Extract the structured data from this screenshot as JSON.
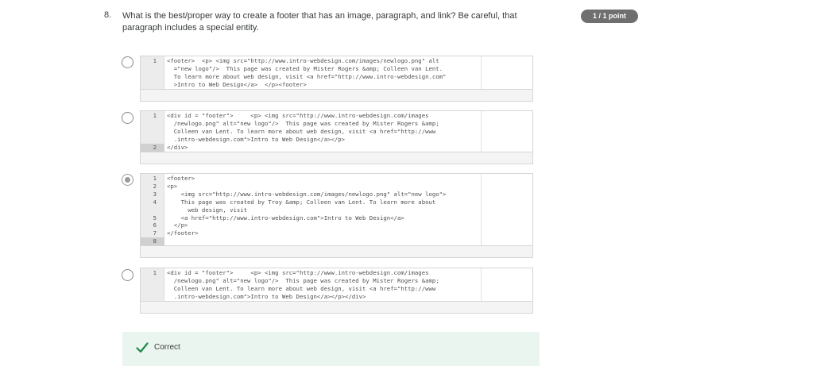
{
  "question": {
    "number": "8.",
    "text": "What is the best/proper way to create a footer that has an image, paragraph, and link? Be careful, that paragraph includes a special entity."
  },
  "score": {
    "label": "1 / 1 point"
  },
  "options": [
    {
      "selected": false,
      "lines": [
        {
          "num": "1",
          "text": "<footer>  <p> <img src=\"http://www.intro-webdesign.com/images/newlogo.png\" alt"
        },
        {
          "num": "",
          "text": "  =\"new logo\"/>  This page was created by Mister Rogers &amp; Colleen van Lent."
        },
        {
          "num": "",
          "text": "  To learn more about web design, visit <a href=\"http://www.intro-webdesign.com\""
        },
        {
          "num": "",
          "text": "  >Intro to Web Design</a>  </p><footer>"
        }
      ]
    },
    {
      "selected": false,
      "lines": [
        {
          "num": "1",
          "text": "<div id = \"footer\">     <p> <img src=\"http://www.intro-webdesign.com/images"
        },
        {
          "num": "",
          "text": "  /newlogo.png\" alt=\"new logo\"/>  This page was created by Mister Rogers &amp;"
        },
        {
          "num": "",
          "text": "  Colleen van Lent. To learn more about web design, visit <a href=\"http://www"
        },
        {
          "num": "",
          "text": "  .intro-webdesign.com\">Intro to Web Design</a></p>"
        },
        {
          "num": "2",
          "text": "</div>"
        }
      ]
    },
    {
      "selected": true,
      "lines": [
        {
          "num": "1",
          "text": "<footer>"
        },
        {
          "num": "2",
          "text": "<p>"
        },
        {
          "num": "3",
          "text": "    <img src=\"http://www.intro-webdesign.com/images/newlogo.png\" alt=\"new logo\">"
        },
        {
          "num": "4",
          "text": "    This page was created by Troy &amp; Colleen van Lent. To learn more about"
        },
        {
          "num": "",
          "text": "      web design, visit"
        },
        {
          "num": "5",
          "text": "    <a href=\"http://www.intro-webdesign.com\">Intro to Web Design</a>"
        },
        {
          "num": "6",
          "text": "  </p>"
        },
        {
          "num": "7",
          "text": "</footer>"
        },
        {
          "num": "8",
          "text": ""
        }
      ]
    },
    {
      "selected": false,
      "lines": [
        {
          "num": "1",
          "text": "<div id = \"footer\">     <p> <img src=\"http://www.intro-webdesign.com/images"
        },
        {
          "num": "",
          "text": "  /newlogo.png\" alt=\"new logo\"/>  This page was created by Mister Rogers &amp;"
        },
        {
          "num": "",
          "text": "  Colleen van Lent. To learn more about web design, visit <a href=\"http://www"
        },
        {
          "num": "",
          "text": "  .intro-webdesign.com\">Intro to Web Design</a></p></div>"
        }
      ]
    }
  ],
  "feedback": {
    "label": "Correct",
    "color": "#1f8a4c",
    "background": "#ebf5ef"
  }
}
